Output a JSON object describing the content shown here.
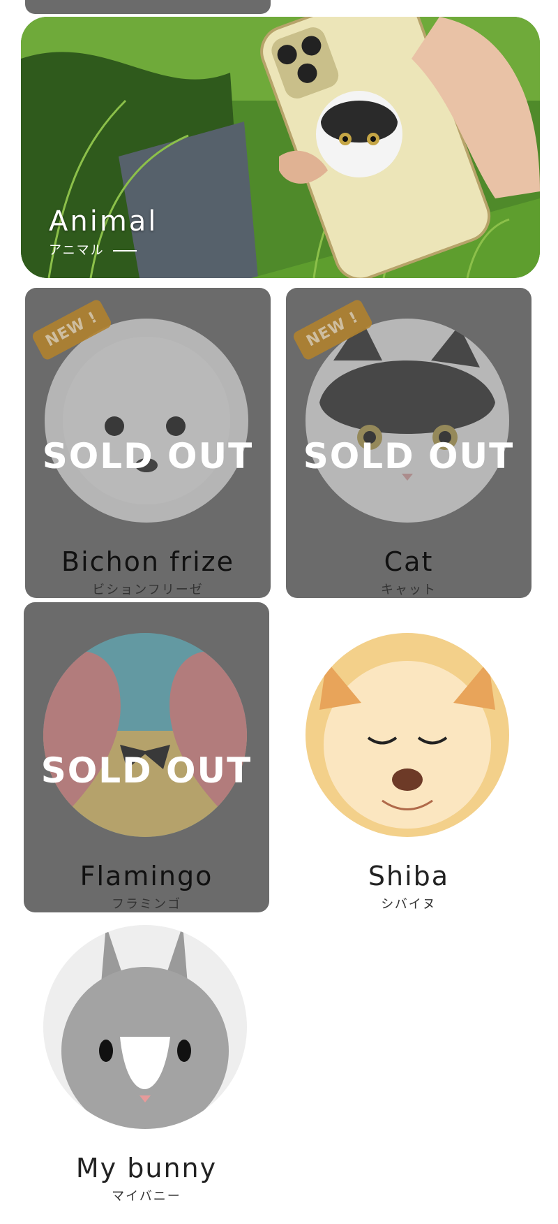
{
  "banner": {
    "title": "Animal",
    "subtitle": "アニマル"
  },
  "products": [
    {
      "name": "Bichon frize",
      "kana": "ビションフリーゼ",
      "badge": "NEW !",
      "status": "SOLD OUT"
    },
    {
      "name": "Cat",
      "kana": "キャット",
      "badge": "NEW !",
      "status": "SOLD OUT"
    },
    {
      "name": "Flamingo",
      "kana": "フラミンゴ",
      "status": "SOLD OUT"
    },
    {
      "name": "Shiba",
      "kana": "シバイヌ"
    },
    {
      "name": "My bunny",
      "kana": "マイバニー"
    }
  ],
  "colors": {
    "soldout_card": "#6b6b6b",
    "badge": "#b0822f"
  }
}
